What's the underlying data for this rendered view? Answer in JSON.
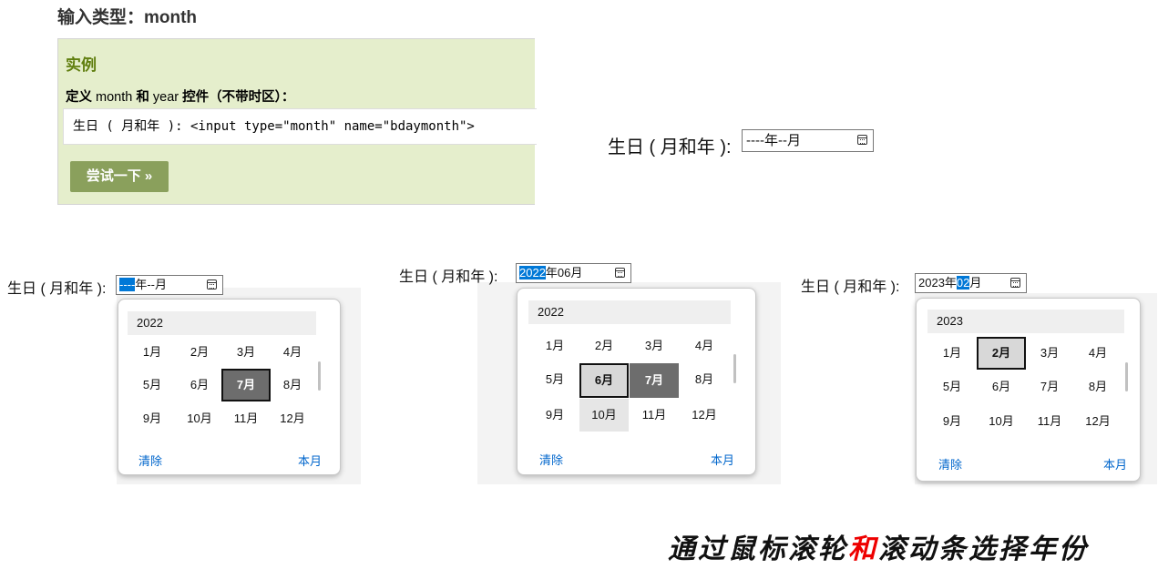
{
  "heading": "输入类型：month",
  "example": {
    "title": "实例",
    "desc_prefix": "定义",
    "desc_month": "month",
    "desc_and": "和",
    "desc_year": "year",
    "desc_suffix": "控件（不带时区）：",
    "code": "生日 ( 月和年 ): <input type=\"month\" name=\"bdaymonth\">",
    "try_button": "尝试一下 »"
  },
  "demo": {
    "label": "生日 ( 月和年 ):",
    "value": "----年--月"
  },
  "panels": [
    {
      "label": "生日 ( 月和年 ):",
      "input_sel": "----",
      "input_rest": "年--月",
      "year": "2022",
      "months": [
        "1月",
        "2月",
        "3月",
        "4月",
        "5月",
        "6月",
        "7月",
        "8月",
        "9月",
        "10月",
        "11月",
        "12月"
      ],
      "current_month": "7月",
      "clear": "清除",
      "this_month": "本月"
    },
    {
      "label": "生日 ( 月和年 ):",
      "input_sel": "2022",
      "input_rest": "年06月",
      "year": "2022",
      "months": [
        "1月",
        "2月",
        "3月",
        "4月",
        "5月",
        "6月",
        "7月",
        "8月",
        "9月",
        "10月",
        "11月",
        "12月"
      ],
      "selected_month": "6月",
      "current_month": "7月",
      "hover_month": "10月",
      "clear": "清除",
      "this_month": "本月"
    },
    {
      "label": "生日 ( 月和年 ):",
      "input_pre": "2023年",
      "input_sel": "02",
      "input_rest": "月",
      "year": "2023",
      "months": [
        "1月",
        "2月",
        "3月",
        "4月",
        "5月",
        "6月",
        "7月",
        "8月",
        "9月",
        "10月",
        "11月",
        "12月"
      ],
      "selected_month": "2月",
      "clear": "清除",
      "this_month": "本月"
    }
  ],
  "caption": {
    "part1": "通过鼠标滚轮",
    "highlight": "和",
    "part2": "滚动条选择年份"
  }
}
